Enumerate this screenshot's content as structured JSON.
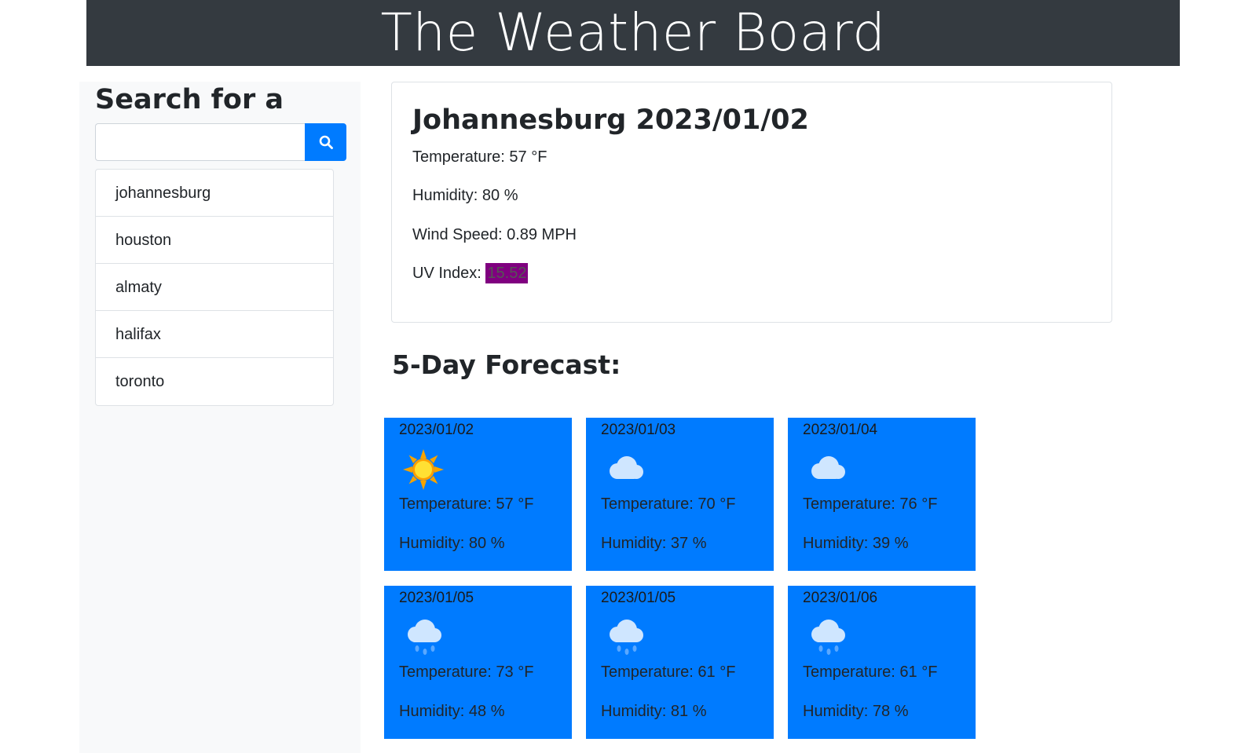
{
  "header": {
    "title": "The Weather Board"
  },
  "sidebar": {
    "heading": "Search for a City:",
    "search": {
      "placeholder": "",
      "value": ""
    },
    "cities": [
      "johannesburg",
      "houston",
      "almaty",
      "halifax",
      "toronto"
    ]
  },
  "current": {
    "title": "Johannesburg 2023/01/02",
    "temperature": "Temperature: 57 °F",
    "humidity": "Humidity: 80 %",
    "wind": "Wind Speed: 0.89 MPH",
    "uv_label": "UV Index: ",
    "uv_value": "15.52",
    "uv_color": "#800080"
  },
  "forecast": {
    "heading": "5-Day Forecast:",
    "days": [
      {
        "date": "2023/01/02",
        "icon": "sun-icon",
        "temp": "Temperature: 57 °F",
        "humidity": "Humidity: 80 %"
      },
      {
        "date": "2023/01/03",
        "icon": "cloud-icon",
        "temp": "Temperature: 70 °F",
        "humidity": "Humidity: 37 %"
      },
      {
        "date": "2023/01/04",
        "icon": "cloud-icon",
        "temp": "Temperature: 76 °F",
        "humidity": "Humidity: 39 %"
      },
      {
        "date": "2023/01/05",
        "icon": "rain-cloud-icon",
        "temp": "Temperature: 73 °F",
        "humidity": "Humidity: 48 %"
      },
      {
        "date": "2023/01/05",
        "icon": "rain-cloud-icon",
        "temp": "Temperature: 61 °F",
        "humidity": "Humidity: 81 %"
      },
      {
        "date": "2023/01/06",
        "icon": "rain-cloud-icon",
        "temp": "Temperature: 61 °F",
        "humidity": "Humidity: 78 %"
      }
    ]
  },
  "colors": {
    "header_bg": "#343a40",
    "accent": "#007bff",
    "sidebar_bg": "#f8f9fa"
  }
}
